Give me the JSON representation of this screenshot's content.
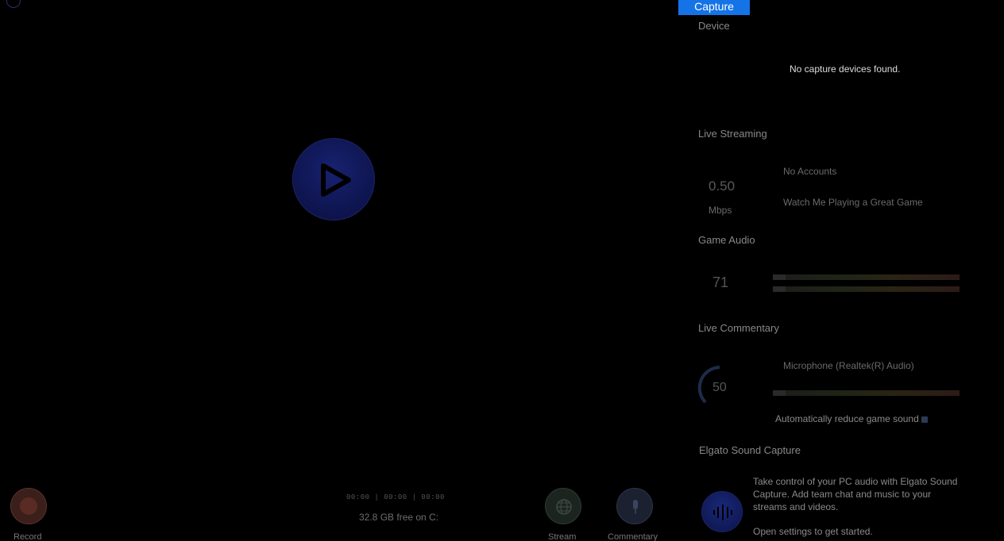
{
  "preview": {
    "timecode": "00:00 | 00:00 | 00:00",
    "disk_free": "32.8 GB free on C:"
  },
  "controls": {
    "record_label": "Record",
    "stream_label": "Stream",
    "commentary_label": "Commentary"
  },
  "panel": {
    "tab_label": "Capture",
    "device": {
      "title": "Device",
      "empty_message": "No capture devices found."
    },
    "live_streaming": {
      "title": "Live Streaming",
      "bitrate": "0.50",
      "bitrate_unit": "Mbps",
      "accounts": "No Accounts",
      "stream_title": "Watch Me Playing a Great Game"
    },
    "game_audio": {
      "title": "Game Audio",
      "volume": "71"
    },
    "live_commentary": {
      "title": "Live Commentary",
      "volume": "50",
      "microphone": "Microphone (Realtek(R) Audio)",
      "auto_reduce": "Automatically reduce game sound",
      "auto_reduce_checked": true
    },
    "sound_capture": {
      "title": "Elgato Sound Capture",
      "description": "Take control of your PC audio with Elgato Sound Capture. Add team chat and music to your streams and videos.",
      "action": "Open settings to get started."
    }
  },
  "colors": {
    "accent": "#1473e6",
    "play_button": "#0e1550",
    "record": "#3a1f1b"
  }
}
